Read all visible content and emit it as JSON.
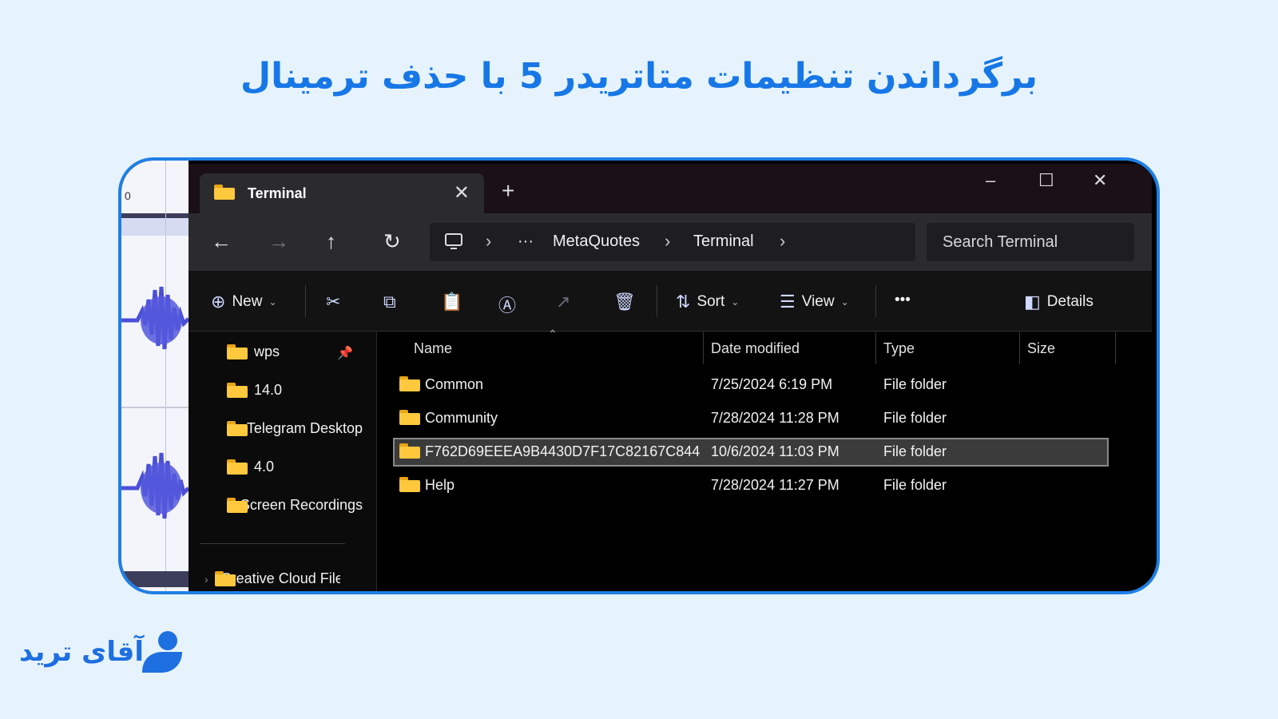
{
  "headline": "برگرداندن تنظیمات متاتریدر 5 با حذف ترمینال",
  "brand": {
    "logo_text": "آقای ترید",
    "color": "#1e6fe0"
  },
  "audio_editor": {
    "tick_label": "0"
  },
  "window": {
    "tab_title": "Terminal",
    "tab_close": "✕",
    "new_tab": "+",
    "controls": {
      "minimize": "–",
      "maximize": "☐",
      "close": "✕"
    }
  },
  "nav": {
    "back": "←",
    "forward": "→",
    "up": "↑",
    "refresh": "↻",
    "breadcrumb": {
      "more": "···",
      "segments": [
        "MetaQuotes",
        "Terminal"
      ]
    },
    "search_placeholder": "Search Terminal"
  },
  "commands": {
    "new": "New",
    "sort": "Sort",
    "view": "View",
    "more": "•••",
    "details": "Details"
  },
  "sidebar": {
    "items": [
      "wps",
      "14.0",
      "Telegram Desktop",
      "4.0",
      "Screen Recordings",
      "Creative Cloud Files"
    ]
  },
  "columns": {
    "name": "Name",
    "date": "Date modified",
    "type": "Type",
    "size": "Size"
  },
  "files": [
    {
      "name": "Common",
      "date": "7/25/2024 6:19 PM",
      "type": "File folder"
    },
    {
      "name": "Community",
      "date": "7/28/2024 11:28 PM",
      "type": "File folder"
    },
    {
      "name": "F762D69EEEA9B4430D7F17C82167C844",
      "date": "10/6/2024 11:03 PM",
      "type": "File folder"
    },
    {
      "name": "Help",
      "date": "7/28/2024 11:27 PM",
      "type": "File folder"
    }
  ],
  "colors": {
    "accent": "#1e7fe5",
    "headline": "#1877e6",
    "folder": "#ffc83d",
    "waveform": "#4b4fd8"
  }
}
